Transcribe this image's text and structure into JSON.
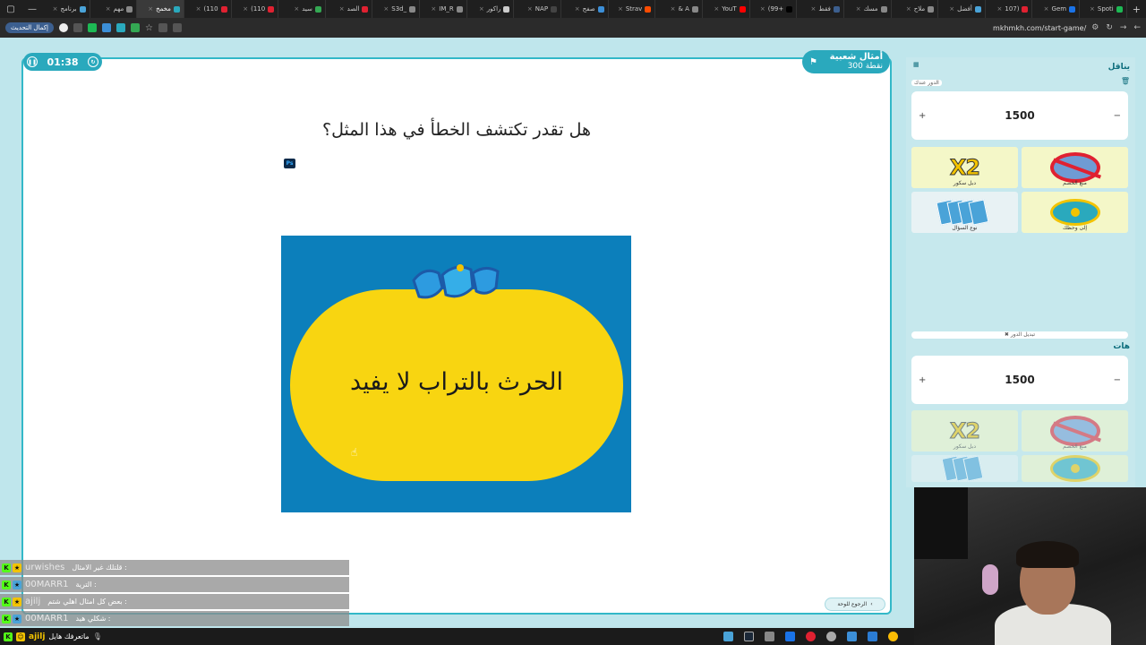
{
  "browser": {
    "tabs": [
      {
        "title": "برنامج",
        "color": "#4aa3d8"
      },
      {
        "title": "مهم",
        "color": "#888888"
      },
      {
        "title": "مخمخ",
        "color": "#2aa9bd",
        "active": true
      },
      {
        "title": "(110",
        "color": "#e02131"
      },
      {
        "title": "(110",
        "color": "#e02131"
      },
      {
        "title": "سيد",
        "color": "#34a853"
      },
      {
        "title": "الصد",
        "color": "#e02131"
      },
      {
        "title": "S3d_",
        "color": "#888888"
      },
      {
        "title": "IM_R",
        "color": "#888888"
      },
      {
        "title": "راكور",
        "color": "#cccccc"
      },
      {
        "title": "NAP",
        "color": "#444444"
      },
      {
        "title": "صفح",
        "color": "#3c8fd8"
      },
      {
        "title": "Strav",
        "color": "#fc4c02"
      },
      {
        "title": "& A",
        "color": "#888888"
      },
      {
        "title": "YouT",
        "color": "#ff0000"
      },
      {
        "title": "(99+",
        "color": "#000000"
      },
      {
        "title": "فقط",
        "color": "#3c5f8f"
      },
      {
        "title": "مسك",
        "color": "#888888"
      },
      {
        "title": "ملاح",
        "color": "#888888"
      },
      {
        "title": "أفضل",
        "color": "#4aa3d8"
      },
      {
        "title": "107)",
        "color": "#e02131"
      },
      {
        "title": "Gem",
        "color": "#1a73e8"
      },
      {
        "title": "Spoti",
        "color": "#1db954"
      }
    ],
    "update_label": "إكمال التحديث",
    "url": "mkhmkh.com/start-game/"
  },
  "game": {
    "timer": "01:38",
    "category_name": "أمثال شعبية",
    "category_points": "300 نقطة",
    "question": "هل تقدر تكتشف الخطأ في هذا المثل؟",
    "ps_badge": "Ps",
    "proverb_text": "الحرث بالتراب لا يفيد",
    "back_label": "الرجوع للوحة",
    "colors": {
      "accent": "#2aa9bd",
      "image_bg": "#0c7fbb",
      "image_pill": "#f8d511"
    }
  },
  "panel": {
    "team1": {
      "name": "يناقل",
      "turn_tag": "الدور عندك",
      "score": "1500",
      "plus": "+",
      "minus": "−",
      "powers": [
        {
          "icon": "x2-icon",
          "label": "دبل سكور",
          "text": "X2"
        },
        {
          "icon": "no-entry-icon",
          "label": "منع الخصم"
        },
        {
          "icon": "cards-icon",
          "label": "نوع السؤال"
        },
        {
          "icon": "wheel-icon",
          "label": "إلى وحظك"
        }
      ]
    },
    "switch_turn": "✖ تبديل الدور",
    "team2": {
      "name": "هات",
      "score": "1500",
      "plus": "+",
      "minus": "−",
      "powers": [
        {
          "icon": "x2-icon",
          "label": "دبل سكور",
          "text": "X2"
        },
        {
          "icon": "no-entry-icon",
          "label": "منع الخصم"
        },
        {
          "icon": "cards-icon",
          "label": ""
        },
        {
          "icon": "wheel-icon",
          "label": ""
        }
      ]
    }
  },
  "chat": [
    {
      "user": "urwishes",
      "msg": ": قلتلك غير الامثال"
    },
    {
      "user": "00MARR1",
      "msg": ": الترية"
    },
    {
      "user": "ajilj",
      "msg": ": بعض كل امثال اهلي شتم"
    },
    {
      "user": "00MARR1",
      "msg": ": شكلي هيد"
    }
  ],
  "taskbar": {
    "text": "ماتعرفك هايل",
    "user": "ajilj"
  }
}
